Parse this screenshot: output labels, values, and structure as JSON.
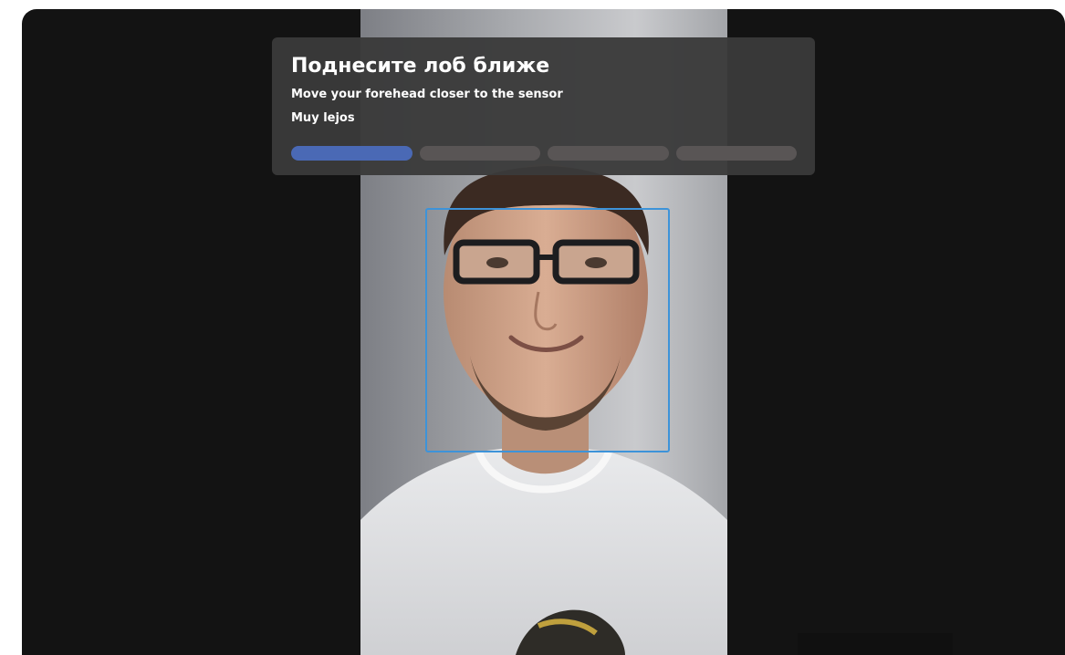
{
  "feedback": {
    "title": "Поднесите лоб ближе",
    "subtitle": "Move your forehead closer to the sensor",
    "status": "Muy lejos",
    "progress": {
      "total_steps": 4,
      "completed_steps": 1
    }
  },
  "colors": {
    "background": "#131313",
    "panel": "#3a3a3a",
    "progress_active": "#4a69b5",
    "progress_inactive": "#595555",
    "face_box": "#3d93d9"
  },
  "camera": {
    "face_detected": true,
    "subject": "person-with-glasses-icon"
  }
}
